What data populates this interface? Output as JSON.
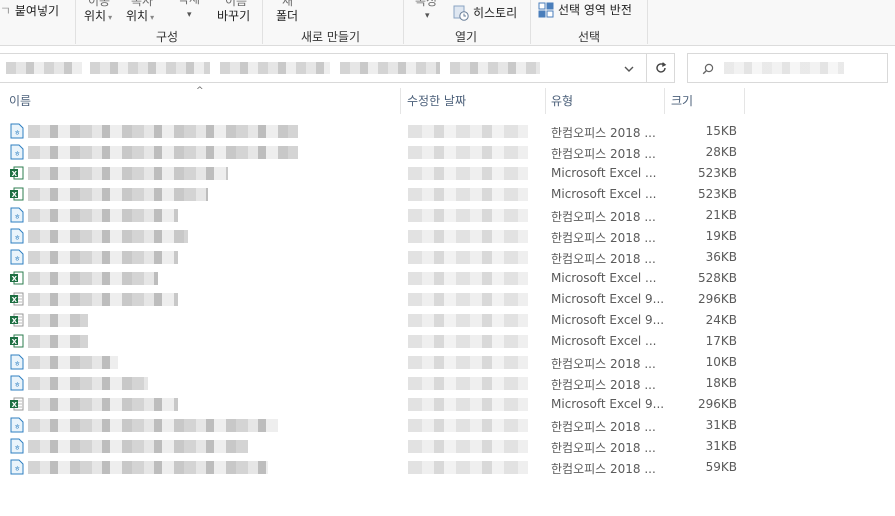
{
  "ribbon": {
    "paste_label": "붙여넣기",
    "move_to_top": "이동",
    "move_to_bottom": "위치",
    "copy_to_top": "복사",
    "copy_to_bottom": "위치",
    "delete_label": "삭제",
    "rename_top": "이름",
    "rename_bottom": "바꾸기",
    "new_folder_top": "새",
    "new_folder_bottom": "폴더",
    "properties_label": "속성",
    "history_label": "히스토리",
    "select_invert_label": "선택 영역 반전",
    "groups": {
      "organize": "구성",
      "new": "새로 만들기",
      "open": "열기",
      "select": "선택"
    }
  },
  "columns": {
    "name": "이름",
    "modified": "수정한 날짜",
    "type": "유형",
    "size": "크기"
  },
  "colors": {
    "excel": "#1d6f42",
    "hancom": "#2f7fc1",
    "header_text": "#4c607a"
  },
  "files": [
    {
      "icon": "hancom-doc-icon",
      "type": "한컴오피스 2018 ...",
      "size": "15KB"
    },
    {
      "icon": "hancom-doc-icon",
      "type": "한컴오피스 2018 ...",
      "size": "28KB"
    },
    {
      "icon": "excel-icon",
      "type": "Microsoft Excel ...",
      "size": "523KB"
    },
    {
      "icon": "excel-icon",
      "type": "Microsoft Excel ...",
      "size": "523KB"
    },
    {
      "icon": "hancom-doc-icon",
      "type": "한컴오피스 2018 ...",
      "size": "21KB"
    },
    {
      "icon": "hancom-doc-icon",
      "type": "한컴오피스 2018 ...",
      "size": "19KB"
    },
    {
      "icon": "hancom-doc-icon",
      "type": "한컴오피스 2018 ...",
      "size": "36KB"
    },
    {
      "icon": "excel-icon",
      "type": "Microsoft Excel ...",
      "size": "528KB"
    },
    {
      "icon": "excel-97-icon",
      "type": "Microsoft Excel 9...",
      "size": "296KB"
    },
    {
      "icon": "excel-97-icon",
      "type": "Microsoft Excel 9...",
      "size": "24KB"
    },
    {
      "icon": "excel-icon",
      "type": "Microsoft Excel ...",
      "size": "17KB"
    },
    {
      "icon": "hancom-doc-icon",
      "type": "한컴오피스 2018 ...",
      "size": "10KB"
    },
    {
      "icon": "hancom-doc-icon",
      "type": "한컴오피스 2018 ...",
      "size": "18KB"
    },
    {
      "icon": "excel-97-icon",
      "type": "Microsoft Excel 9...",
      "size": "296KB"
    },
    {
      "icon": "hancom-doc-icon",
      "type": "한컴오피스 2018 ...",
      "size": "31KB"
    },
    {
      "icon": "hancom-doc-icon",
      "type": "한컴오피스 2018 ...",
      "size": "31KB"
    },
    {
      "icon": "hancom-doc-icon",
      "type": "한컴오피스 2018 ...",
      "size": "59KB"
    }
  ]
}
